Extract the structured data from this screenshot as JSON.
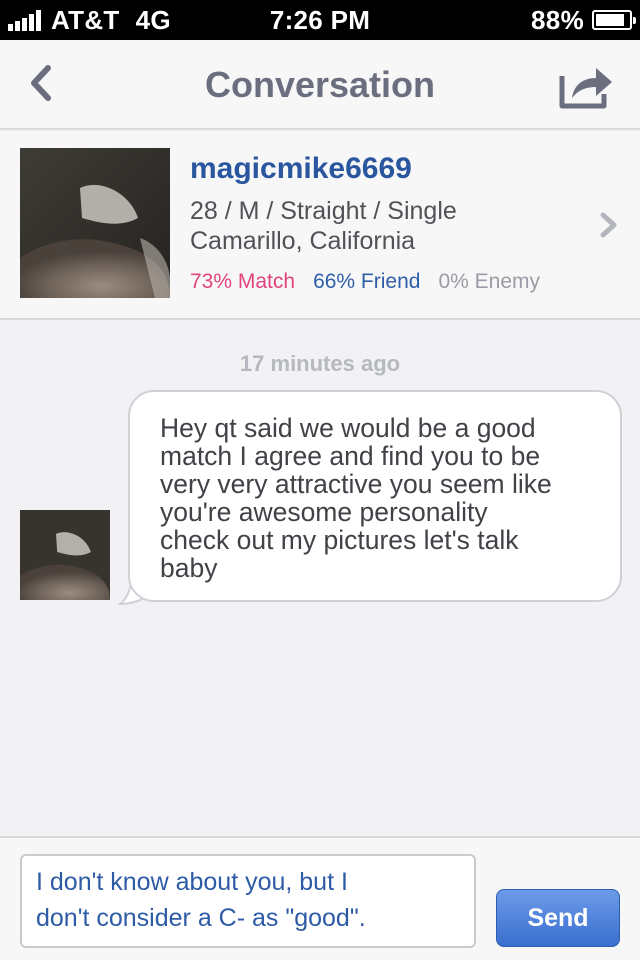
{
  "status_bar": {
    "carrier": "AT&T",
    "network": "4G",
    "time": "7:26 PM",
    "battery_percent": "88%",
    "battery_level": 0.88
  },
  "nav": {
    "title": "Conversation",
    "back_icon": "chevron-left-icon",
    "share_icon": "share-icon"
  },
  "profile": {
    "username": "magicmike6669",
    "details_line1": "28 / M / Straight / Single",
    "details_line2": "Camarillo, California",
    "match": "73% Match",
    "friend": "66% Friend",
    "enemy": "0% Enemy",
    "colors": {
      "username": "#2a56a0",
      "match": "#e2447e",
      "friend": "#2f5ea8",
      "enemy": "#9a9ca4"
    }
  },
  "conversation": {
    "timestamp": "17 minutes ago",
    "messages": [
      {
        "lines": [
          "Hey qt said we would be a good",
          "match I agree and find you to be",
          "very very attractive you seem like",
          "you're awesome personality",
          "check out my pictures let's talk",
          "baby"
        ]
      }
    ]
  },
  "composer": {
    "draft_lines": [
      "I don't know about you, but I",
      "don't consider a C- as \"good\"."
    ],
    "send_label": "Send"
  }
}
